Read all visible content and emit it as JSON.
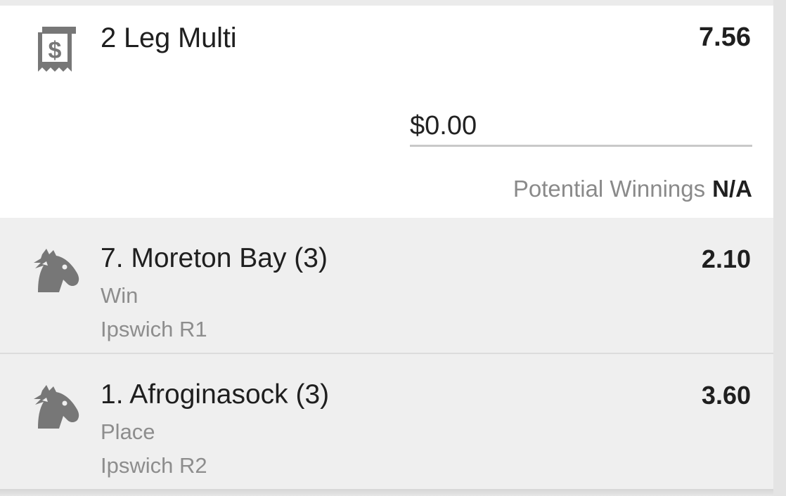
{
  "multi": {
    "title": "2 Leg Multi",
    "odds": "7.56",
    "icon": "receipt-dollar-icon"
  },
  "stake": {
    "value": "$0.00"
  },
  "potential_winnings": {
    "label": "Potential Winnings",
    "value": "N/A"
  },
  "legs": [
    {
      "runner": "7. Moreton Bay (3)",
      "odds": "2.10",
      "bet_type": "Win",
      "race": "Ipswich R1",
      "icon": "horse-head-icon"
    },
    {
      "runner": "1. Afroginasock (3)",
      "odds": "3.60",
      "bet_type": "Place",
      "race": "Ipswich R2",
      "icon": "horse-head-icon"
    }
  ],
  "colors": {
    "card_background": "#ffffff",
    "leg_background": "#efefef",
    "icon": "#7a7a7a",
    "secondary_text": "#8d8d8d"
  }
}
